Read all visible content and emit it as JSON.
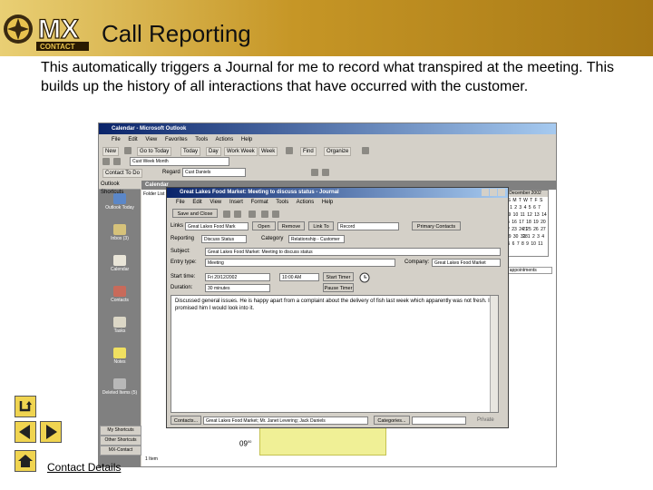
{
  "slide": {
    "title": "Call Reporting",
    "description": "This automatically triggers a Journal for me to record what transpired at the meeting. This builds up the history of all interactions that have occurred with the customer.",
    "link_text": "Contact Details"
  },
  "logo": {
    "text": "MX",
    "sub": "CONTACT"
  },
  "outlook": {
    "window_title": "Calendar - Microsoft Outlook",
    "menu": [
      "File",
      "Edit",
      "View",
      "Favorites",
      "Tools",
      "Actions",
      "Help"
    ],
    "toolbar": {
      "new": "New",
      "today": "Today",
      "day": "Day",
      "work_week": "Work Week",
      "week": "Week",
      "organize": "Organize",
      "go_to_today": "Go to Today",
      "find": "Find"
    },
    "address_value": "Cust Week Month",
    "contact_todo": "Contact To Do",
    "regarding_label": "Regard",
    "regarding_value": "Cust Daniels",
    "sidebar_header": "Outlook Shortcuts",
    "sidebar_items": [
      "Outlook Today",
      "Inbox (3)",
      "Calendar",
      "Contacts",
      "Tasks",
      "Notes",
      "Deleted Items (5)"
    ],
    "sidebar_buttons": [
      "My Shortcuts",
      "Other Shortcuts",
      "MX-Contact"
    ],
    "folder_list": "Folder List",
    "calendar_header": "Calendar",
    "mini_calendar": {
      "month": "December 2002",
      "days": "S M T W T F S",
      "rows": [
        "1 2 3 4 5 6 7",
        "8 9 10 11 12 13 14",
        "15 16 17 18 19 20 21",
        "22 23 24 25 26 27 28",
        "29 30 31 1 2 3 4",
        "5 6 7 8 9 10 11"
      ]
    },
    "time_label": "09",
    "time_suffix": "00",
    "appt_text": "No appointments",
    "status": "1 Item"
  },
  "journal": {
    "title": "Great Lakes Food Market: Meeting to discuss status - Journal",
    "menu": [
      "File",
      "Edit",
      "View",
      "Insert",
      "Format",
      "Tools",
      "Actions",
      "Help"
    ],
    "save_close": "Save and Close",
    "links_label": "Links",
    "links_value": "Great Lakes Food Mark",
    "open": "Open",
    "remove": "Remove",
    "link_to": "Link To",
    "record": "Record",
    "primary_contacts": "Primary Contacts",
    "reporting_label": "Reporting",
    "reporting_value": "Discuss Status",
    "category_label": "Category",
    "category_value": "Relationship - Customer",
    "subject_label": "Subject:",
    "subject_value": "Great Lakes Food Market: Meeting to discuss status",
    "entry_type_label": "Entry type:",
    "entry_type_value": "Meeting",
    "company_label": "Company:",
    "company_value": "Great Lakes Food Market",
    "start_time_label": "Start time:",
    "start_date": "Fri 20/12/2002",
    "start_clock": "10:00 AM",
    "start_timer": "Start Timer",
    "pause_timer": "Pause Timer",
    "duration_label": "Duration:",
    "duration_value": "30 minutes",
    "notes": "Discussed general issues. He is happy apart from a complaint about the delivery of fish last week which apparently was not fresh. I promised him I would look into it.",
    "contacts_btn": "Contacts...",
    "contacts_value": "Great Lakes Food Market; Mr. Janet Levering; Jack Daniels",
    "categories_btn": "Categories...",
    "private_label": "Private"
  },
  "colors": {
    "header_gold": "#c69626",
    "titlebar_blue": "#0a246a",
    "button_yellow": "#f0d450",
    "sidebar_gray": "#808080"
  }
}
